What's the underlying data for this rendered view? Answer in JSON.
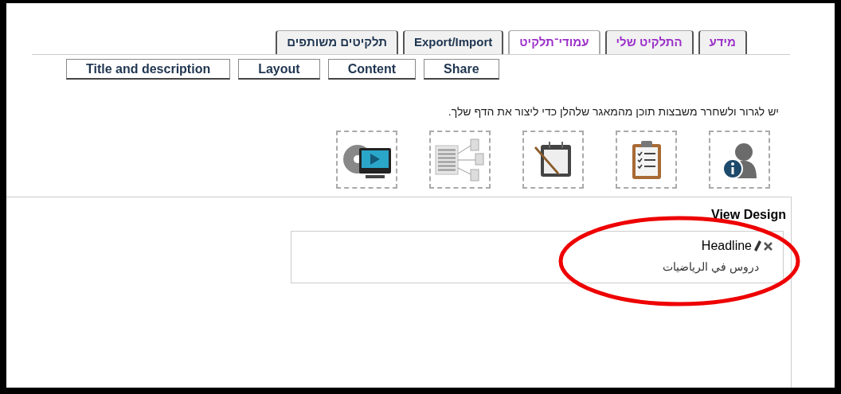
{
  "tabs": [
    {
      "label": "מידע",
      "selected": false,
      "color": "#9b30c8"
    },
    {
      "label": "התלקיט שלי",
      "selected": false,
      "color": "#9b30c8"
    },
    {
      "label": "עמודי־תלקיט",
      "selected": true,
      "color": "#9b30c8"
    },
    {
      "label": "Export/Import",
      "selected": false,
      "color": "#1f3550"
    },
    {
      "label": "תלקיטים משותפים",
      "selected": false,
      "color": "#1f3550"
    }
  ],
  "sub_buttons": [
    "Share",
    "Content",
    "Layout",
    "Title and description"
  ],
  "instruction": "יש לגרור ולשחרר משבצות תוכן מהמאגר שלהלן כדי ליצור את הדף שלך.",
  "widgets": [
    {
      "kind": "profile"
    },
    {
      "kind": "checklist"
    },
    {
      "kind": "notes"
    },
    {
      "kind": "diagram"
    },
    {
      "kind": "video"
    }
  ],
  "view_design": {
    "title": "View Design",
    "block": {
      "title": "Headline",
      "text": "دروس في الرياضيات"
    }
  }
}
